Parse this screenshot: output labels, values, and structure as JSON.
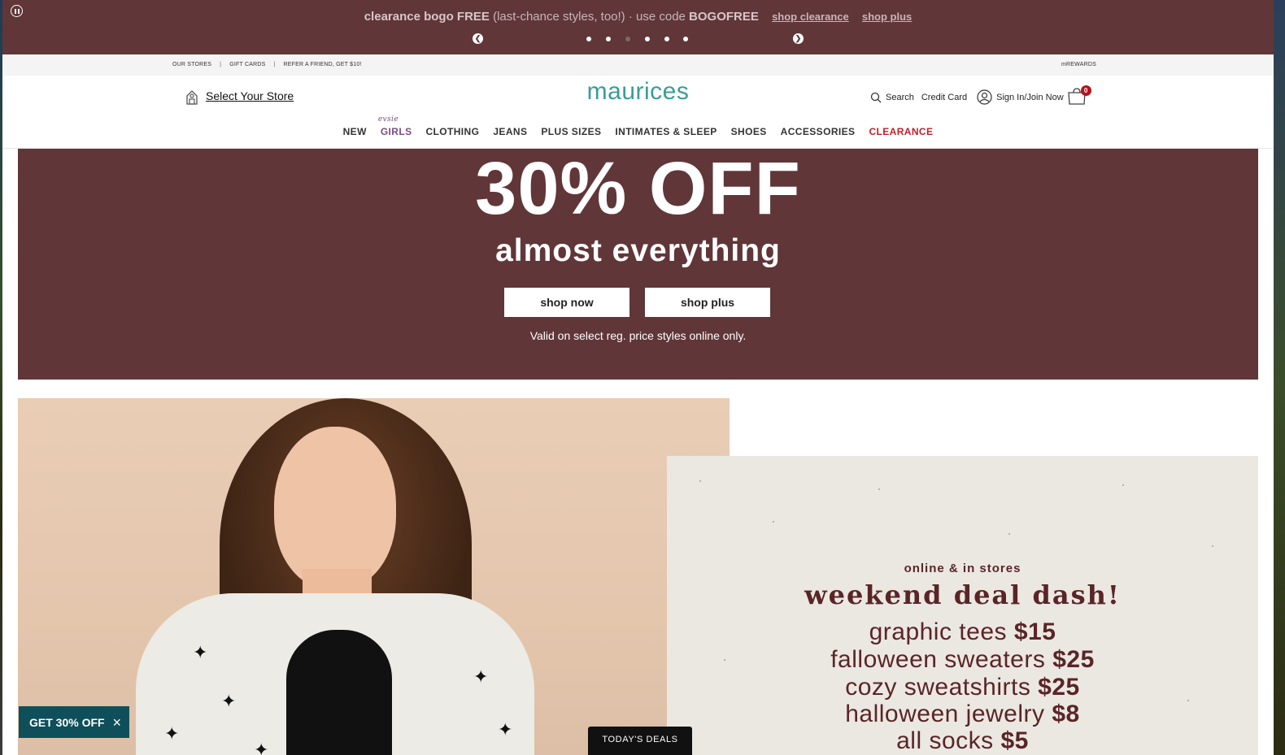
{
  "promo_bar": {
    "lead": "clearance bogo FREE",
    "middle": " (last-chance styles, too!) · use code ",
    "code": "BOGOFREE",
    "link1": "shop clearance",
    "link2": "shop plus",
    "slides_total": 6,
    "active_slide": 3,
    "pause_icon": "pause-icon",
    "prev_icon": "chevron-left-icon",
    "next_icon": "chevron-right-icon"
  },
  "utility": {
    "links": [
      "OUR STORES",
      "GIFT CARDS",
      "REFER A FRIEND, GET $10!"
    ],
    "separator": "|",
    "rewards": "mREWARDS"
  },
  "header": {
    "store_label": "Select Your Store",
    "logo": "maurices",
    "search": "Search",
    "credit_card": "Credit Card",
    "sign_in": "Sign In/Join Now",
    "cart_count": "0"
  },
  "nav": {
    "items": [
      "NEW",
      "GIRLS",
      "CLOTHING",
      "JEANS",
      "PLUS SIZES",
      "INTIMATES & SLEEP",
      "SHOES",
      "ACCESSORIES",
      "CLEARANCE"
    ],
    "girls_tag": "evsie"
  },
  "hero": {
    "headline": "30% OFF",
    "subhead": "almost everything",
    "button1": "shop now",
    "button2": "shop plus",
    "note": "Valid on select reg. price styles online only."
  },
  "deal_panel": {
    "kicker": "online & in stores",
    "headline": "weekend deal dash!",
    "lines": [
      {
        "item": "graphic tees",
        "price": "$15"
      },
      {
        "item": "falloween sweaters",
        "price": "$25"
      },
      {
        "item": "cozy sweatshirts",
        "price": "$25"
      },
      {
        "item": "halloween jewelry",
        "price": "$8"
      },
      {
        "item": "all socks",
        "price": "$5"
      }
    ]
  },
  "sticky": {
    "offer": "GET 30% OFF",
    "close": "×",
    "deals": "TODAY'S DEALS"
  },
  "colors": {
    "promo_bg": "#603638",
    "hero_bg": "#613638",
    "logo": "#3b9c96",
    "clearance": "#c21f2b",
    "girls": "#7d4a85",
    "offer_bg": "#0f4f5a"
  }
}
